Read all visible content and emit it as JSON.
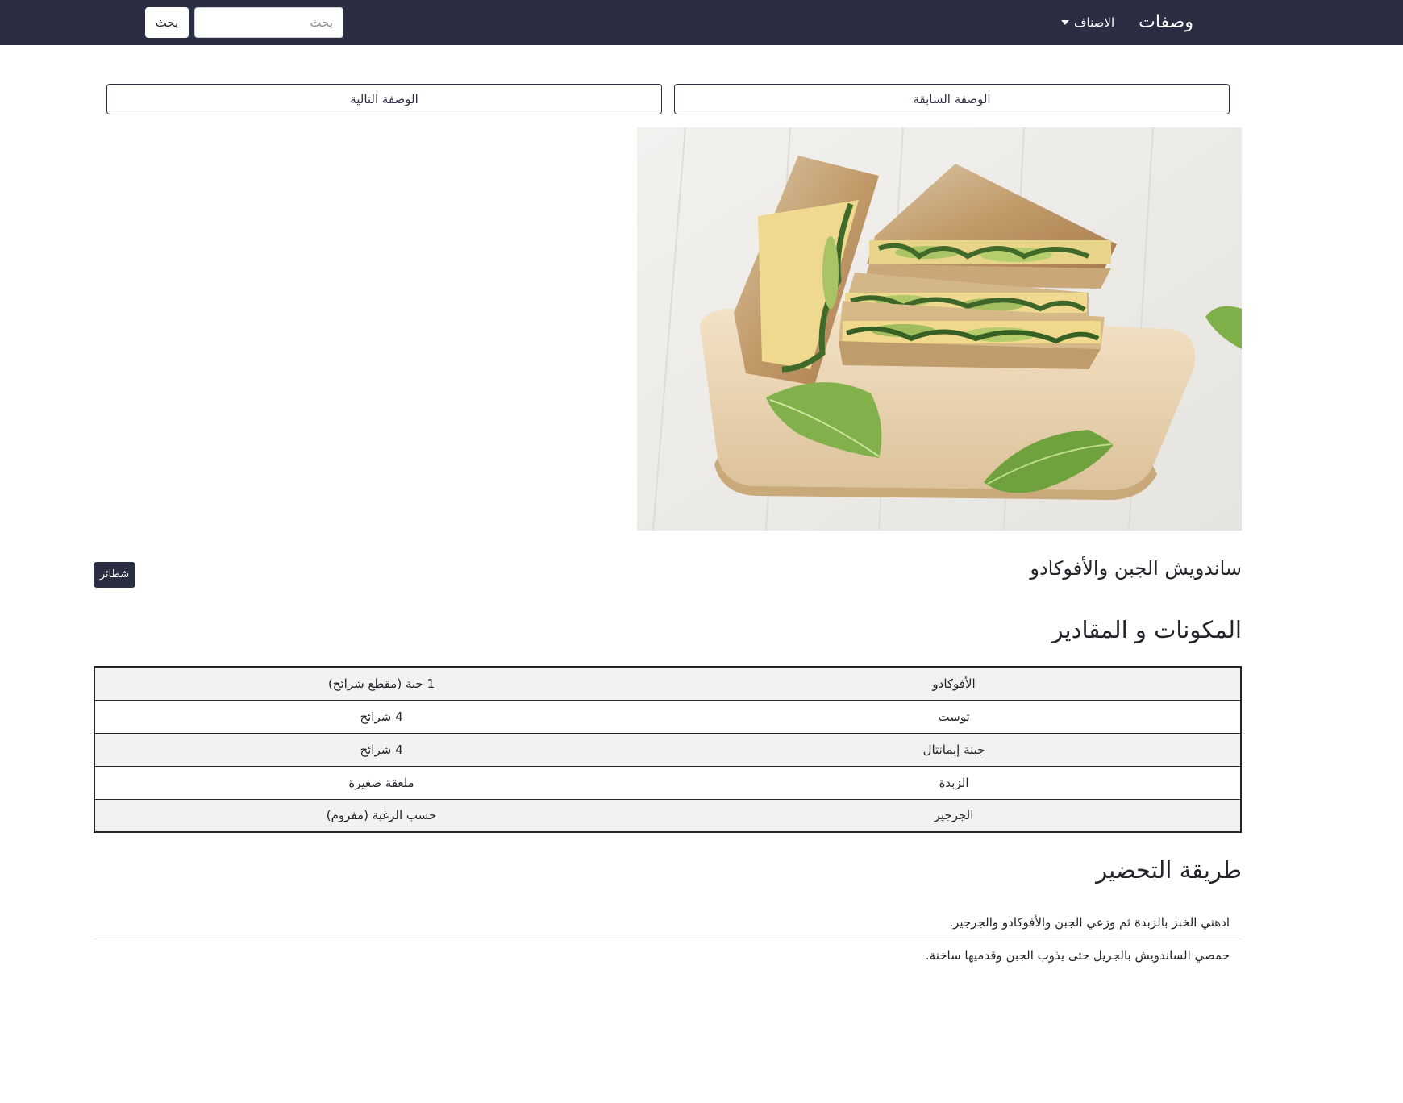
{
  "navbar": {
    "brand": "وصفات",
    "categories_label": "الاصناف",
    "search_placeholder": "بحث",
    "search_button": "بحث"
  },
  "navigation": {
    "previous": "الوصفة السابقة",
    "next": "الوصفة التالية"
  },
  "recipe": {
    "title": "ساندويش الجبن والأفوكادو",
    "category": "شطائر"
  },
  "ingredients": {
    "heading": "المكونات و المقادير",
    "items": [
      {
        "name": "الأفوكادو",
        "amount": "1 حبة (مقطع شرائح)"
      },
      {
        "name": "توست",
        "amount": "4 شرائح"
      },
      {
        "name": "جبنة إيمانتال",
        "amount": "4 شرائح"
      },
      {
        "name": "الزبدة",
        "amount": "ملعقة صغيرة"
      },
      {
        "name": "الجرجير",
        "amount": "حسب الرغبة (مفروم)"
      }
    ]
  },
  "steps": {
    "heading": "طريقة التحضير",
    "items": [
      "ادهني الخبز بالزبدة ثم وزعي الجبن والأفوكادو والجرجير.",
      "حمصي الساندويش بالجريل حتى يذوب الجبن وقدميها ساخنة."
    ]
  },
  "colors": {
    "navbar": "#2b2d42",
    "accent": "#2b2d42",
    "stripe": "#f2f2f2"
  }
}
